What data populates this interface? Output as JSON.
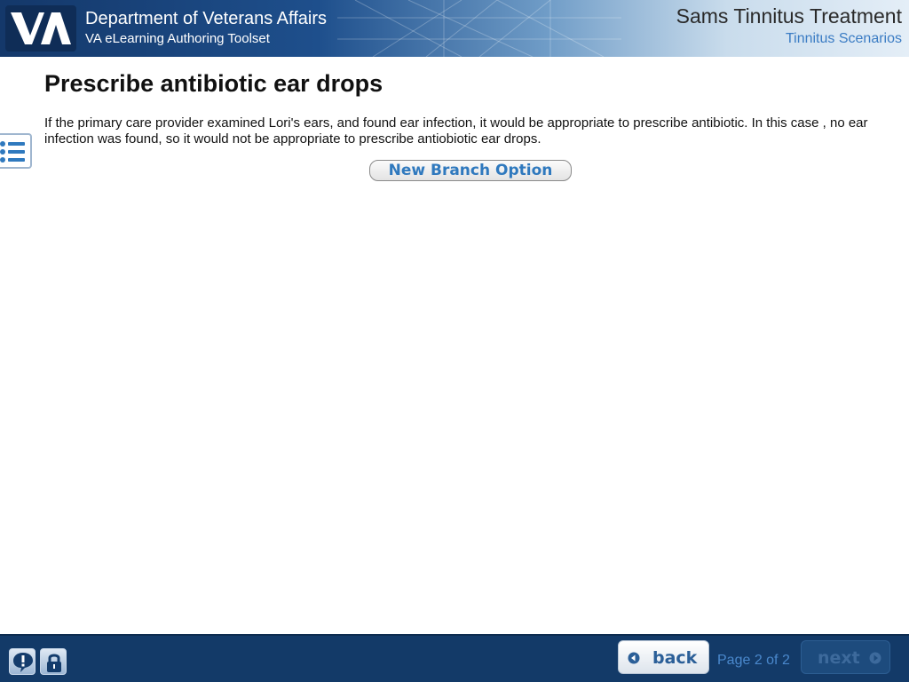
{
  "header": {
    "org_name": "Department of Veterans Affairs",
    "toolset_name": "VA eLearning Authoring Toolset",
    "course_title": "Sams Tinnitus Treatment",
    "course_subtitle": "Tinnitus Scenarios",
    "logo_icon": "va-logo-icon"
  },
  "menu": {
    "icon": "list-menu-icon"
  },
  "content": {
    "title": "Prescribe antibiotic ear drops",
    "body": "If the primary care provider examined Lori's ears, and found ear infection, it would be appropriate to prescribe antibiotic.  In this case , no ear infection was found, so it would not be appropriate to prescribe antiobiotic ear drops.",
    "branch_button_label": "New Branch Option"
  },
  "footer": {
    "help_icon": "help-exclamation-icon",
    "lock_icon": "lock-icon",
    "back_label": "back",
    "page_indicator": "Page 2 of 2",
    "next_label": "next",
    "next_enabled": false
  },
  "colors": {
    "header_dark": "#14386a",
    "footer_bg": "#133a68",
    "accent_blue": "#2f79be",
    "subtitle_blue": "#3b7cc4"
  }
}
